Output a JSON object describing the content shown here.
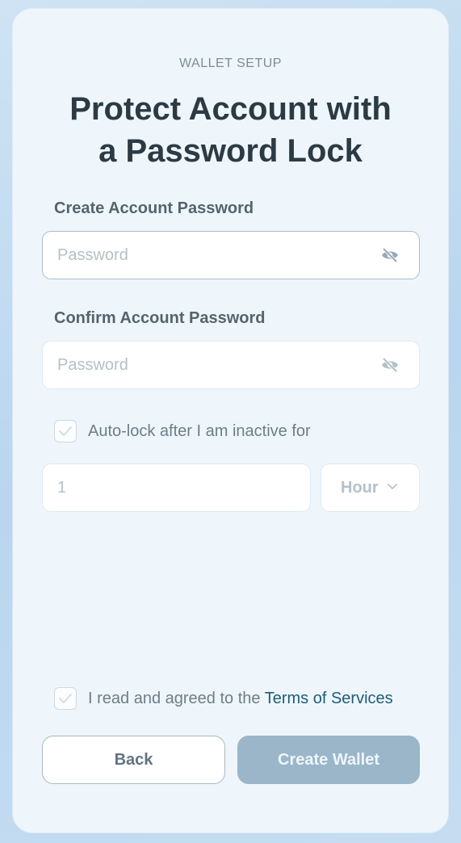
{
  "header": {
    "eyebrow": "WALLET SETUP",
    "title_line1": "Protect Account with",
    "title_line2": "a Password Lock"
  },
  "create_password": {
    "label": "Create Account Password",
    "placeholder": "Password",
    "toggle_icon": "eye-off-icon"
  },
  "confirm_password": {
    "label": "Confirm Account Password",
    "placeholder": "Password",
    "toggle_icon": "eye-off-icon"
  },
  "auto_lock": {
    "label": "Auto-lock after I am inactive for",
    "checked": true,
    "duration_value": "1",
    "unit_selected": "Hour"
  },
  "terms": {
    "text": "I read and agreed to the",
    "link": "Terms of Services",
    "checked": true
  },
  "buttons": {
    "back": "Back",
    "create": "Create Wallet"
  },
  "colors": {
    "title": "#2c3a44",
    "link": "#1f5c78",
    "create_button": "#9bb6c9",
    "card_background": "#eef6fb"
  }
}
